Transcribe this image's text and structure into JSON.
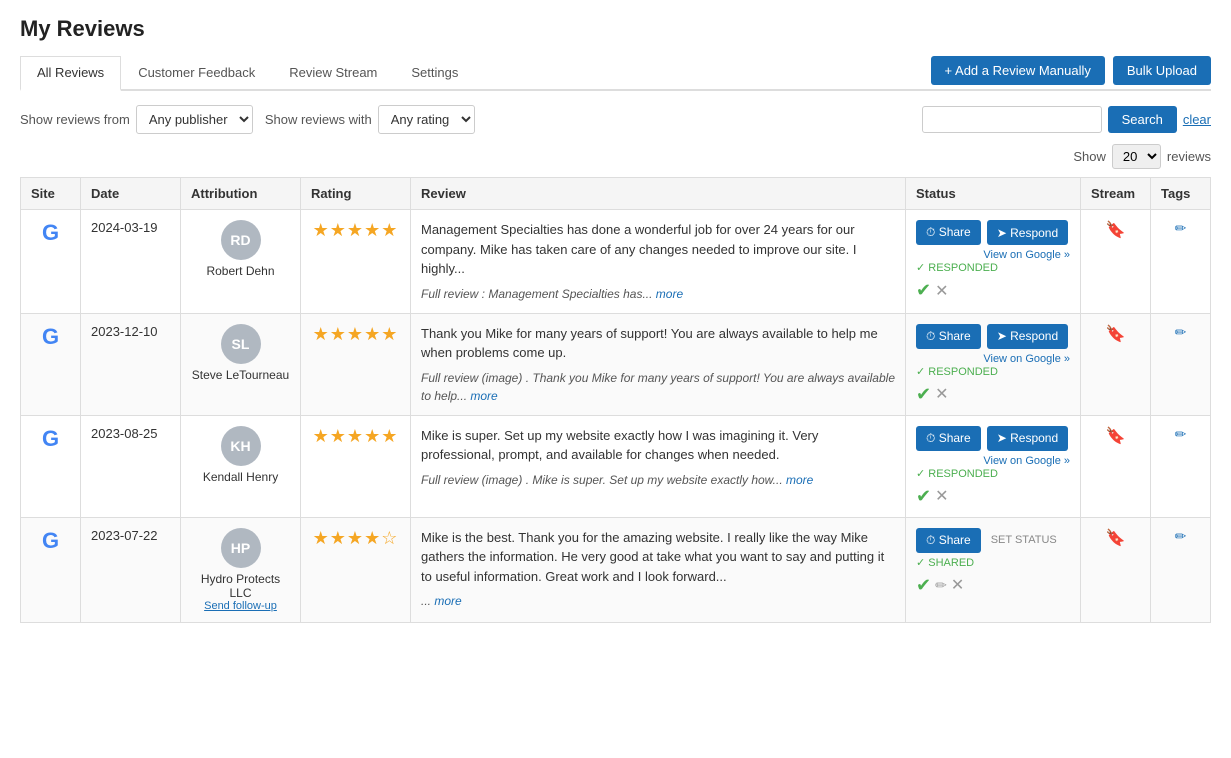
{
  "page": {
    "title": "My Reviews"
  },
  "tabs": [
    {
      "id": "all-reviews",
      "label": "All Reviews",
      "active": true
    },
    {
      "id": "customer-feedback",
      "label": "Customer Feedback",
      "active": false
    },
    {
      "id": "review-stream",
      "label": "Review Stream",
      "active": false
    },
    {
      "id": "settings",
      "label": "Settings",
      "active": false
    }
  ],
  "actions": {
    "add_review": "+ Add a Review Manually",
    "bulk_upload": "Bulk Upload"
  },
  "filters": {
    "show_from_label": "Show reviews from",
    "publisher_default": "Any publisher",
    "show_with_label": "Show reviews with",
    "rating_default": "Any rating",
    "search_placeholder": "",
    "search_btn": "Search",
    "clear_btn": "clear",
    "show_label": "Show",
    "show_count": "20",
    "reviews_label": "reviews"
  },
  "table": {
    "headers": [
      "Site",
      "Date",
      "Attribution",
      "Rating",
      "Review",
      "Status",
      "Stream",
      "Tags"
    ],
    "rows": [
      {
        "site": "G",
        "date": "2024-03-19",
        "avatar_initials": "RD",
        "avatar_bg": "#b0b8c1",
        "attr_name": "Robert Dehn",
        "stars": 5,
        "review_main": "Management Specialties has done a wonderful job for over 24 years for our company. Mike has taken care of any changes needed to improve our site. I highly...",
        "review_full": "Full review : Management Specialties has...",
        "review_full_link": "more",
        "has_image": false,
        "status_share": "Share",
        "status_respond": "Respond",
        "view_google": "View on Google »",
        "responded": "✓ RESPONDED",
        "followed_up": false,
        "set_status": false,
        "shared": false
      },
      {
        "site": "G",
        "date": "2023-12-10",
        "avatar_initials": "SL",
        "avatar_bg": "#b0b8c1",
        "attr_name": "Steve LeTourneau",
        "stars": 5,
        "review_main": "Thank you Mike for many years of support! You are always available to help me when problems come up.",
        "review_full": "Full review (image) . Thank you Mike for many years of support! You are always available to help...",
        "review_full_link": "more",
        "has_image": true,
        "status_share": "Share",
        "status_respond": "Respond",
        "view_google": "View on Google »",
        "responded": "✓ RESPONDED",
        "followed_up": false,
        "set_status": false,
        "shared": false
      },
      {
        "site": "G",
        "date": "2023-08-25",
        "avatar_initials": "KH",
        "avatar_bg": "#b0b8c1",
        "attr_name": "Kendall Henry",
        "stars": 5,
        "review_main": "Mike is super. Set up my website exactly how I was imagining it. Very professional, prompt, and available for changes when needed.",
        "review_full": "Full review (image) . Mike is super. Set up my website exactly how...",
        "review_full_link": "more",
        "has_image": true,
        "status_share": "Share",
        "status_respond": "Respond",
        "view_google": "View on Google »",
        "responded": "✓ RESPONDED",
        "followed_up": false,
        "set_status": false,
        "shared": false
      },
      {
        "site": "G",
        "date": "2023-07-22",
        "avatar_initials": "HP",
        "avatar_bg": "#b0b8c1",
        "attr_name": "Hydro Protects LLC",
        "stars": 4,
        "review_main": "Mike is the best. Thank you for the amazing website. I really like the way Mike gathers the information. He very good at take what you want to say and putting it to useful information. Great work and I look forward...",
        "review_full_link": "more",
        "has_image": false,
        "review_full": "",
        "status_share": "Share",
        "status_respond": null,
        "view_google": null,
        "responded": null,
        "set_status": "SET STATUS",
        "shared": "✓ SHARED",
        "followed_up": true,
        "followup_label": "Send follow-up"
      }
    ]
  }
}
